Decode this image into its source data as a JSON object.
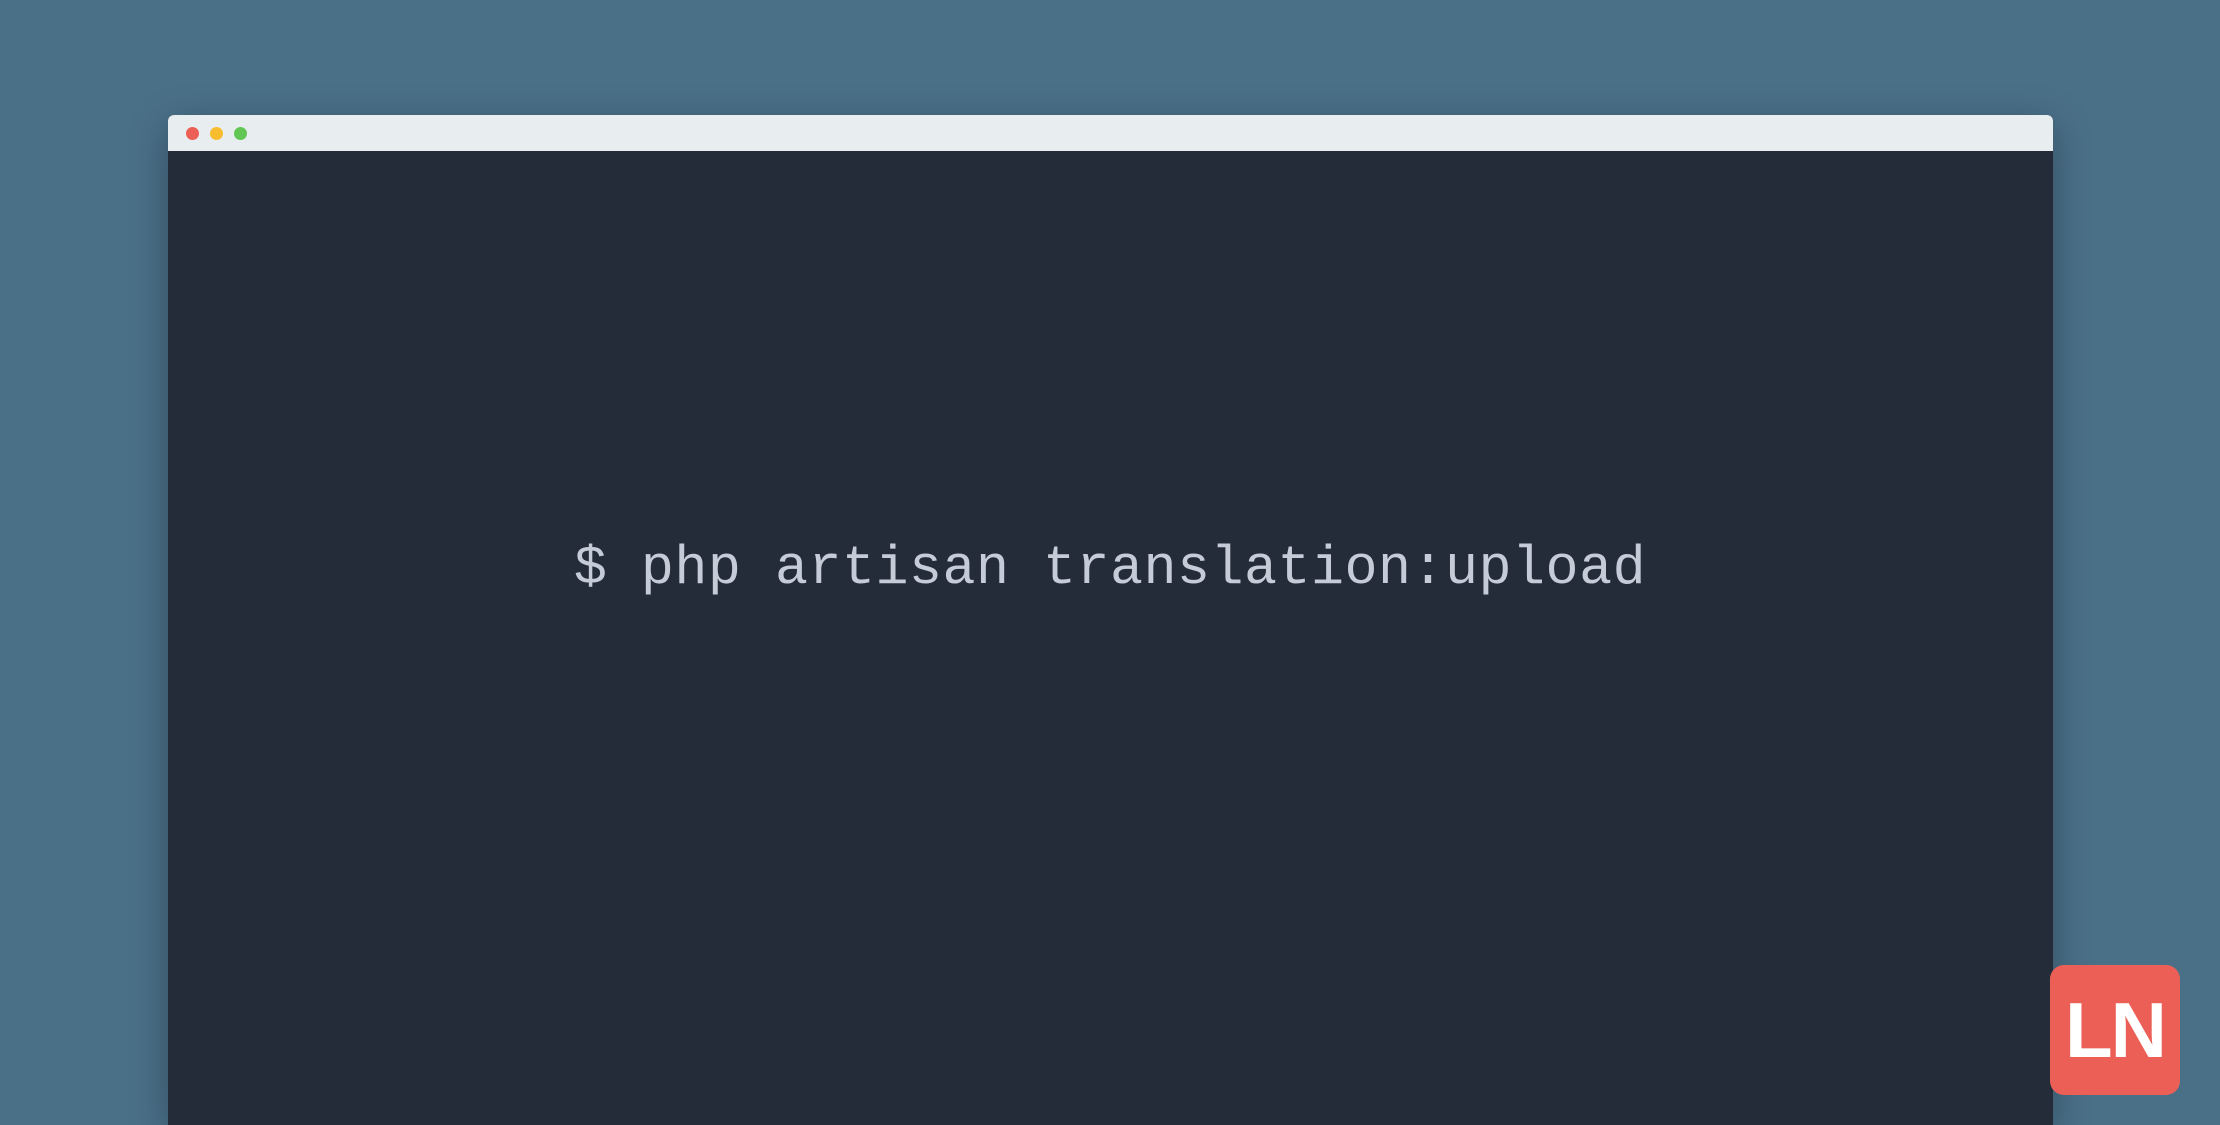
{
  "terminal": {
    "command": "$ php artisan translation:upload"
  },
  "traffic_lights": {
    "close": "close-icon",
    "minimize": "minimize-icon",
    "maximize": "maximize-icon"
  },
  "logo": {
    "text": "LN"
  },
  "colors": {
    "background": "#4a7088",
    "terminal_bg": "#242c3a",
    "titlebar_bg": "#e8edf0",
    "text": "#c5ccd8",
    "red": "#ec5f56",
    "yellow": "#f8bd2f",
    "green": "#61c654",
    "logo_bg": "#ec5f56"
  }
}
